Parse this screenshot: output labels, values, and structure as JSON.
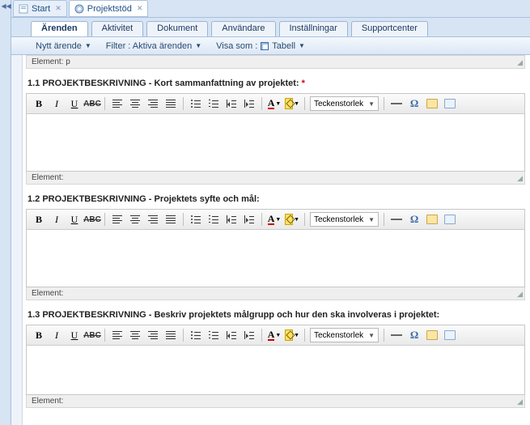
{
  "topTabs": {
    "start": "Start",
    "project": "Projektstöd"
  },
  "moduleTabs": {
    "arenden": "Ärenden",
    "aktivitet": "Aktivitet",
    "dokument": "Dokument",
    "anvandare": "Användare",
    "installningar": "Inställningar",
    "support": "Supportcenter"
  },
  "toolbar": {
    "new": "Nytt ärende",
    "filter": "Filter : Aktiva ärenden",
    "viewAsLabel": "Visa som :",
    "viewAsValue": "Tabell"
  },
  "elementPrefix": "Element:",
  "topElementValue": " p",
  "sections": [
    {
      "title": "1.1 PROJEKTBESKRIVNING - Kort sammanfattning av projektet:",
      "required": true
    },
    {
      "title": "1.2 PROJEKTBESKRIVNING - Projektets syfte och mål:",
      "required": false
    },
    {
      "title": "1.3 PROJEKTBESKRIVNING - Beskriv projektets målgrupp och hur den ska involveras i projektet:",
      "required": false
    }
  ],
  "rte": {
    "fontSizeLabel": "Teckenstorlek"
  }
}
